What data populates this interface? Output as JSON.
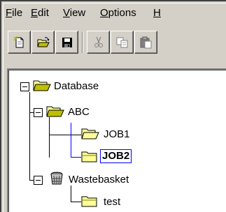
{
  "menu": {
    "file": {
      "acc": "F",
      "rest": "ile"
    },
    "edit": {
      "acc": "E",
      "rest": "dit"
    },
    "view": {
      "acc": "V",
      "rest": "iew"
    },
    "options": {
      "acc": "O",
      "rest": "ptions"
    },
    "help": {
      "acc": "H",
      "rest": ""
    }
  },
  "toolbar": {
    "buttons": [
      {
        "icon": "new-document-icon"
      },
      {
        "icon": "open-folder-icon"
      },
      {
        "icon": "save-disk-icon"
      },
      {
        "icon": "cut-scissors-icon"
      },
      {
        "icon": "copy-icon"
      },
      {
        "icon": "paste-icon"
      }
    ]
  },
  "tree": {
    "root": {
      "label": "Database",
      "icon": "open-folder-icon",
      "expanded": true
    },
    "abc": {
      "label": "ABC",
      "icon": "open-folder-icon",
      "expanded": true
    },
    "job1": {
      "label": "JOB1",
      "icon": "open-folder-icon"
    },
    "job2": {
      "label": "JOB2",
      "icon": "folder-icon",
      "selected": true
    },
    "wastebasket": {
      "label": "Wastebasket",
      "icon": "wastebasket-icon",
      "expanded": true
    },
    "test": {
      "label": "test",
      "icon": "folder-icon"
    }
  },
  "colors": {
    "window_bg": "#d4d0c8",
    "folder_yellow": "#ffff99",
    "folder_edge": "#808000",
    "selection_border": "#0000ff"
  }
}
